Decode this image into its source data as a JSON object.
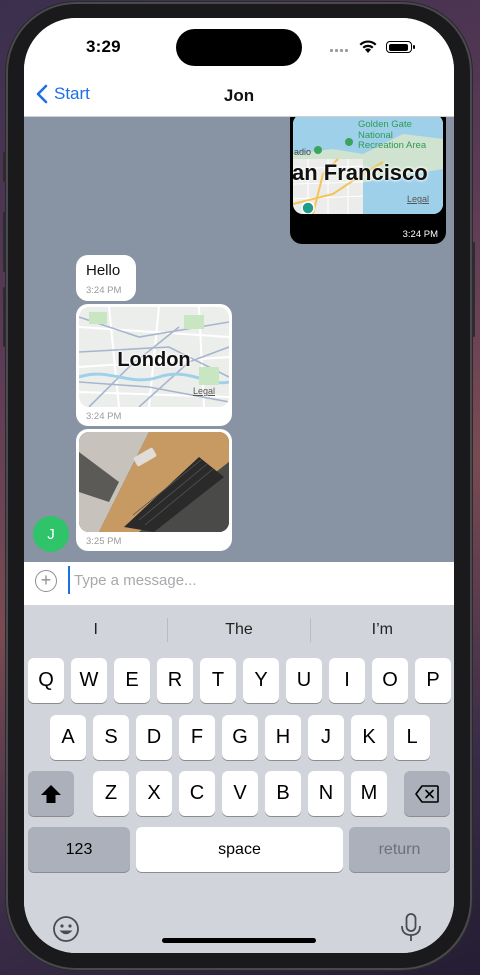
{
  "status_bar": {
    "time": "3:29"
  },
  "nav": {
    "back_label": "Start",
    "title": "Jon"
  },
  "messages": [
    {
      "direction": "outgoing",
      "type": "location",
      "map_label": "an Francisco",
      "map_sublabel": "Golden Gate National Recreation Area",
      "map_place_1": "adio",
      "map_legal": "Legal",
      "time": "3:24 PM"
    },
    {
      "direction": "incoming",
      "type": "text",
      "text": "Hello",
      "time": "3:24 PM"
    },
    {
      "direction": "incoming",
      "type": "location",
      "map_label": "London",
      "map_legal": "Legal",
      "time": "3:24 PM"
    },
    {
      "direction": "incoming",
      "type": "photo",
      "time": "3:25 PM"
    }
  ],
  "avatar": {
    "initial": "J",
    "color": "#2fc46a"
  },
  "composer": {
    "placeholder": "Type a message..."
  },
  "keyboard": {
    "suggestions": [
      "I",
      "The",
      "I’m"
    ],
    "row1": [
      "Q",
      "W",
      "E",
      "R",
      "T",
      "Y",
      "U",
      "I",
      "O",
      "P"
    ],
    "row2": [
      "A",
      "S",
      "D",
      "F",
      "G",
      "H",
      "J",
      "K",
      "L"
    ],
    "row3": [
      "Z",
      "X",
      "C",
      "V",
      "B",
      "N",
      "M"
    ],
    "numbers_label": "123",
    "space_label": "space",
    "return_label": "return"
  },
  "colors": {
    "accent": "#1d6fe5",
    "chat_background": "#8893a3",
    "keyboard": "#d1d4da"
  }
}
